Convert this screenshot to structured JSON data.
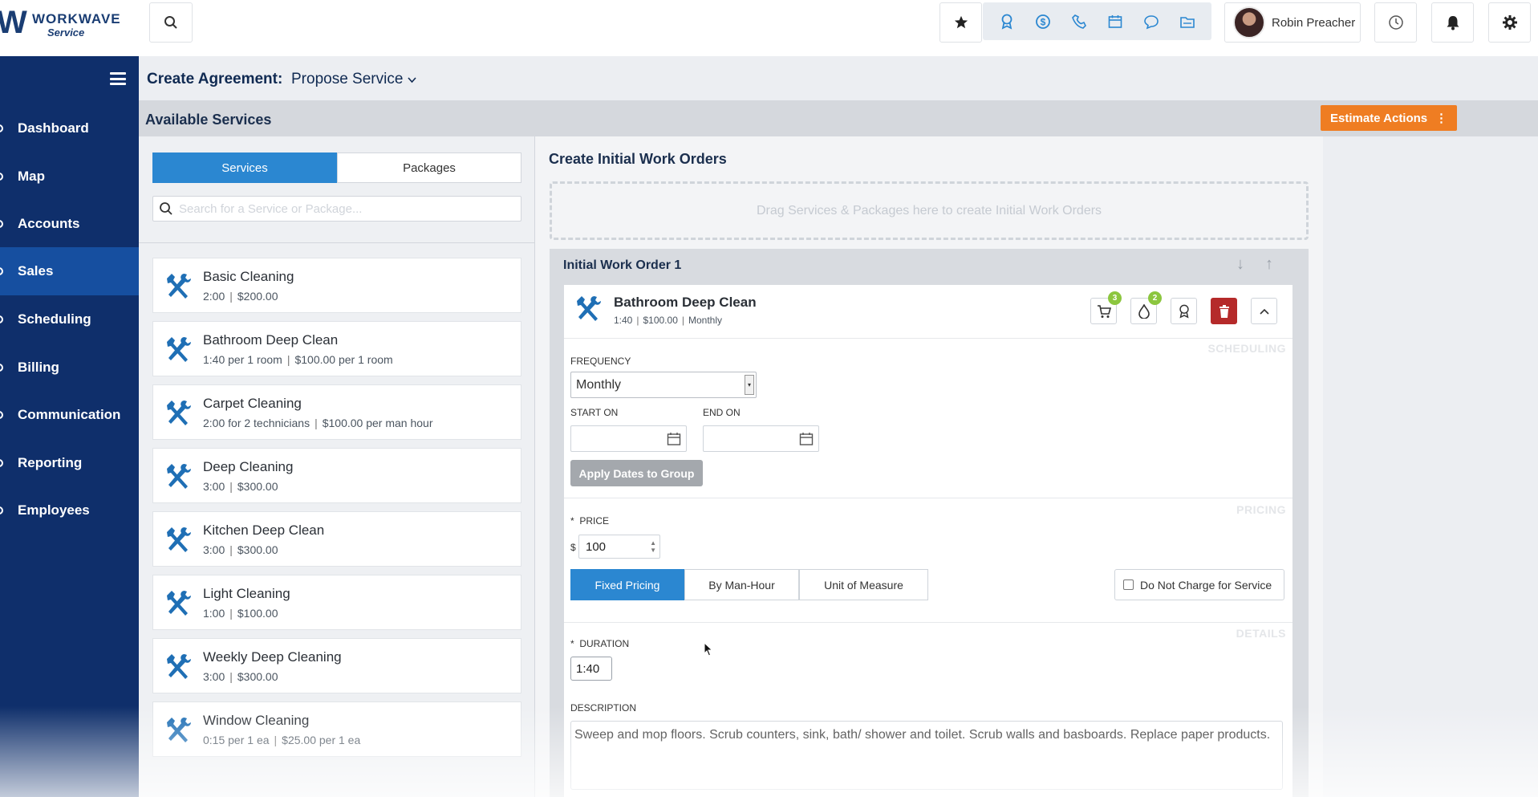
{
  "header": {
    "brand": "WORKWAVE",
    "brand_sub": "Service",
    "user_name": "Robin Preacher",
    "quick_icons": [
      "award-icon",
      "dollar-icon",
      "phone-icon",
      "calendar-icon",
      "chat-icon",
      "folder-icon"
    ]
  },
  "sidebar": {
    "items": [
      {
        "label": "Dashboard"
      },
      {
        "label": "Map"
      },
      {
        "label": "Accounts"
      },
      {
        "label": "Sales"
      },
      {
        "label": "Scheduling"
      },
      {
        "label": "Billing"
      },
      {
        "label": "Communication"
      },
      {
        "label": "Reporting"
      },
      {
        "label": "Employees"
      }
    ],
    "active": "Sales"
  },
  "crumb": {
    "title": "Create Agreement:",
    "selected": "Propose Service"
  },
  "available": {
    "title": "Available Services",
    "estimate_label": "Estimate Actions"
  },
  "left": {
    "tabs": [
      "Services",
      "Packages"
    ],
    "active_tab": "Services",
    "search_placeholder": "Search for a Service or Package...",
    "services": [
      {
        "name": "Basic Cleaning",
        "meta": [
          "2:00",
          "$200.00"
        ]
      },
      {
        "name": "Bathroom Deep Clean",
        "meta": [
          "1:40 per 1 room",
          "$100.00 per 1 room"
        ]
      },
      {
        "name": "Carpet Cleaning",
        "meta": [
          "2:00 for 2 technicians",
          "$100.00 per man hour"
        ]
      },
      {
        "name": "Deep Cleaning",
        "meta": [
          "3:00",
          "$300.00"
        ]
      },
      {
        "name": "Kitchen Deep Clean",
        "meta": [
          "3:00",
          "$300.00"
        ]
      },
      {
        "name": "Light Cleaning",
        "meta": [
          "1:00",
          "$100.00"
        ]
      },
      {
        "name": "Weekly Deep Cleaning",
        "meta": [
          "3:00",
          "$300.00"
        ]
      },
      {
        "name": "Window Cleaning",
        "meta": [
          "0:15 per 1 ea",
          "$25.00 per 1 ea"
        ]
      }
    ]
  },
  "right": {
    "title": "Create Initial Work Orders",
    "dropzone": "Drag Services & Packages here to create Initial Work Orders",
    "work_order": {
      "title": "Initial Work Order 1",
      "service": {
        "name": "Bathroom Deep Clean",
        "meta": [
          "1:40",
          "$100.00",
          "Monthly"
        ],
        "cart_badge": "3",
        "drop_badge": "2"
      },
      "scheduling_label": "SCHEDULING",
      "frequency_label": "FREQUENCY",
      "frequency_value": "Monthly",
      "start_label": "START ON",
      "end_label": "END ON",
      "apply_dates_label": "Apply Dates to Group",
      "pricing_label": "PRICING",
      "price_label": "PRICE",
      "currency": "$",
      "price_value": "100",
      "pricing_options": [
        "Fixed Pricing",
        "By Man-Hour",
        "Unit of Measure"
      ],
      "pricing_active": "Fixed Pricing",
      "no_charge_label": "Do Not Charge for Service",
      "details_label": "DETAILS",
      "duration_label": "DURATION",
      "duration_value": "1:40",
      "description_label": "DESCRIPTION",
      "description_value": "Sweep and mop floors. Scrub counters, sink, bath/ shower and toilet. Scrub walls and basboards. Replace paper products."
    }
  },
  "colors": {
    "sidebar": "#0f2f6b",
    "sidebar_active": "#164fa0",
    "accent": "#2b87d1",
    "estimate": "#ef7d22",
    "trash": "#b52a2a",
    "badge": "#8cc63f"
  }
}
